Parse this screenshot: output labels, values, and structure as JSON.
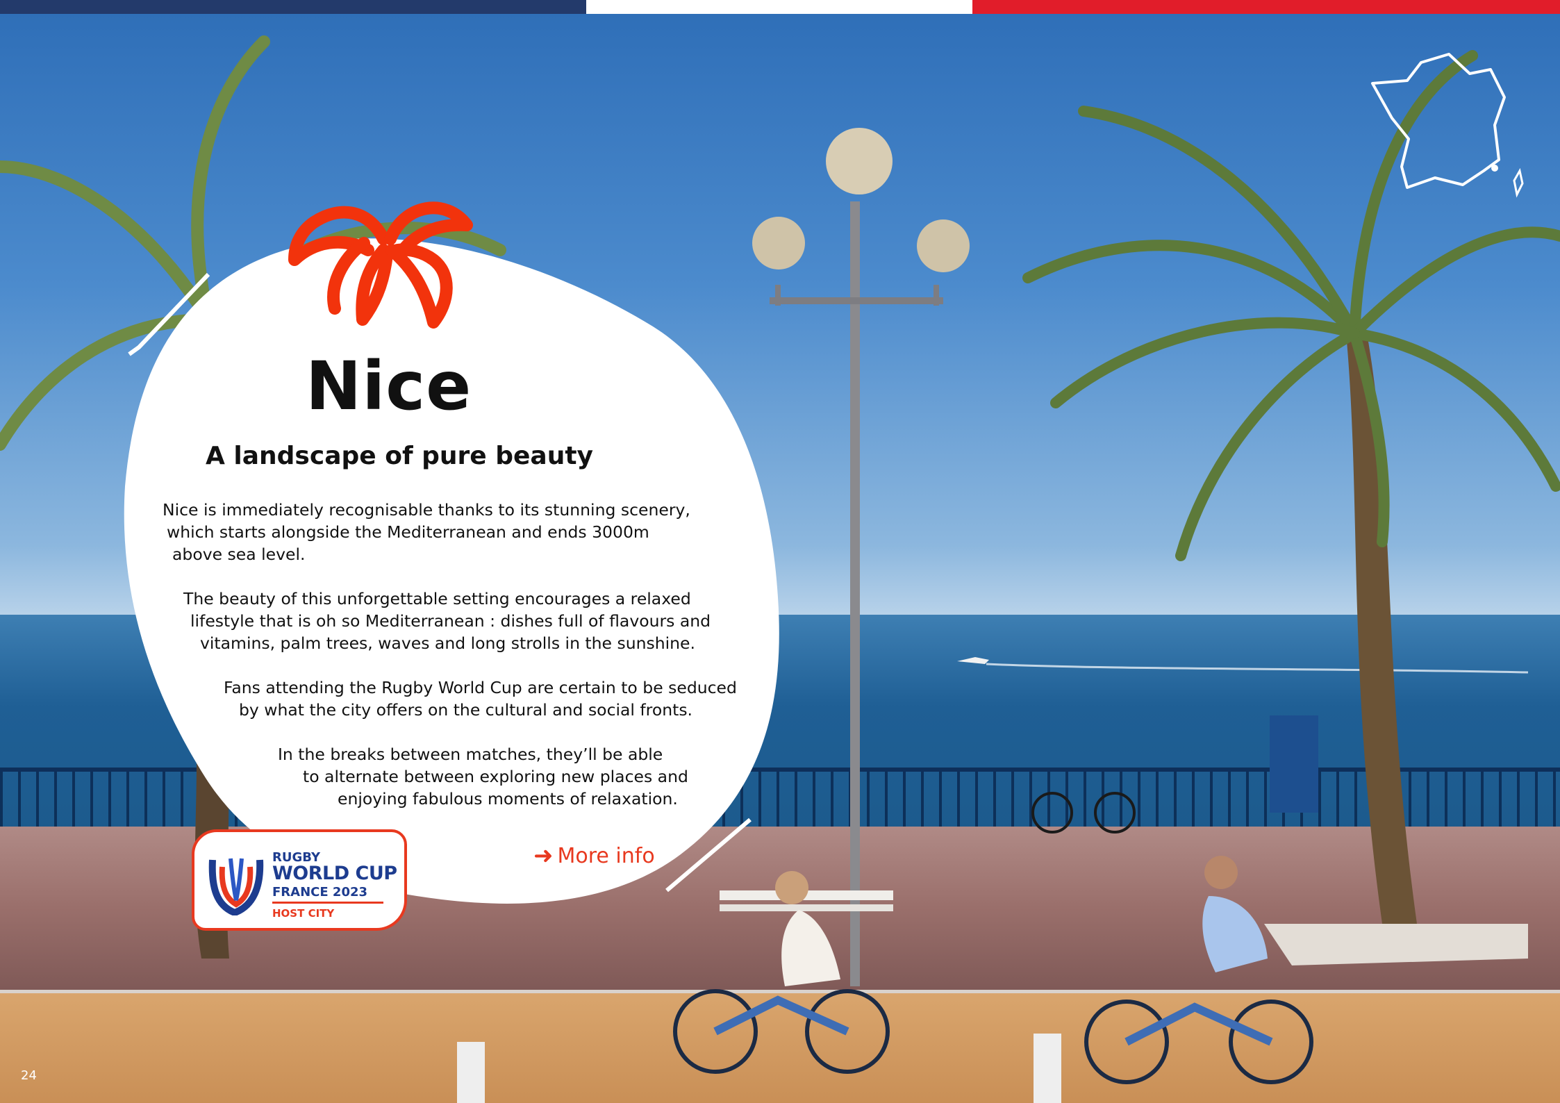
{
  "flag": {
    "blue": "#233a6b",
    "white": "#ffffff",
    "red": "#e11d2a"
  },
  "page": {
    "title": "Nice",
    "subtitle": "A landscape of pure beauty",
    "paragraphs": [
      [
        "Nice is immediately recognisable thanks to its stunning scenery,",
        "which starts alongside the Mediterranean and ends 3000m",
        "above sea level."
      ],
      [
        "The beauty of this unforgettable setting encourages a relaxed",
        "lifestyle that is oh so Mediterranean : dishes full of flavours and",
        "vitamins, palm trees, waves and long strolls in the sunshine."
      ],
      [
        "Fans attending the Rugby World Cup are certain to be seduced",
        "by what the city offers on the cultural and social fronts."
      ],
      [
        "In the breaks between matches, they’ll be able",
        "to alternate between exploring new places and",
        "enjoying fabulous moments of relaxation."
      ]
    ],
    "more_info": "More info",
    "page_number": "24"
  },
  "badge": {
    "line1": "RUGBY",
    "line2": "WORLD CUP",
    "line3": "FRANCE 2023",
    "line4": "HOST CITY"
  },
  "icons": [
    "palm-tree-icon",
    "france-map-icon",
    "arrow-right-icon",
    "rugby-world-cup-logo"
  ],
  "colors": {
    "accent": "#e8391f",
    "text": "#111111",
    "badge_blue": "#1d3c8f"
  }
}
